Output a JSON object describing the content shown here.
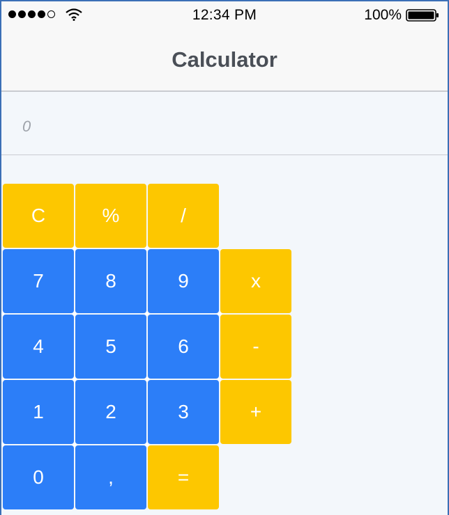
{
  "status_bar": {
    "time": "12:34 PM",
    "battery_percent": "100%",
    "signal_bars_filled": 4,
    "signal_bars_total": 5
  },
  "nav": {
    "title": "Calculator"
  },
  "display": {
    "value": "0"
  },
  "keys": {
    "clear": "C",
    "percent": "%",
    "divide": "/",
    "multiply": "x",
    "minus": "-",
    "plus": "+",
    "equals": "=",
    "seven": "7",
    "eight": "8",
    "nine": "9",
    "four": "4",
    "five": "5",
    "six": "6",
    "one": "1",
    "two": "2",
    "three": "3",
    "zero": "0",
    "decimal": ","
  },
  "colors": {
    "operator_key": "#fdc700",
    "digit_key": "#2c7ef8",
    "background": "#f3f7fb"
  },
  "icons": {
    "signal": "signal-dots-icon",
    "wifi": "wifi-icon",
    "battery": "battery-icon"
  }
}
